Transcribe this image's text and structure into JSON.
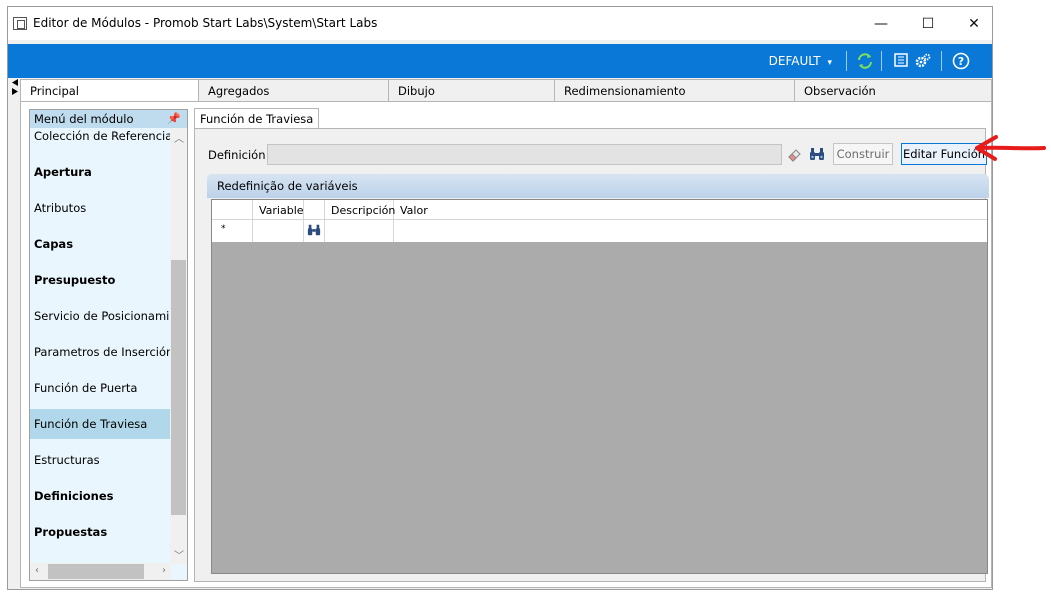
{
  "window": {
    "title": "Editor de Módulos - Promob Start Labs\\System\\Start Labs",
    "minimize": "—",
    "maximize": "☐",
    "close": "✕"
  },
  "toolbar": {
    "profile": "DEFAULT",
    "profile_caret": "▾",
    "icons": [
      "refresh-icon",
      "module-list-icon",
      "settings-gears-icon",
      "help-icon"
    ],
    "accent": "#0a78d7"
  },
  "tabs": [
    {
      "label": "Principal",
      "active": true
    },
    {
      "label": "Agregados"
    },
    {
      "label": "Dibujo"
    },
    {
      "label": "Redimensionamiento"
    },
    {
      "label": "Observación"
    }
  ],
  "left_panel": {
    "header": "Menú del módulo",
    "items": [
      {
        "label": "Colección de Referencias"
      },
      {
        "label": "Apertura",
        "bold": true
      },
      {
        "label": "Atributos"
      },
      {
        "label": "Capas",
        "bold": true
      },
      {
        "label": "Presupuesto",
        "bold": true
      },
      {
        "label": "Servicio de Posicionamiento"
      },
      {
        "label": "Parametros de Inserción"
      },
      {
        "label": "Función de Puerta"
      },
      {
        "label": "Función de Traviesa",
        "selected": true
      },
      {
        "label": "Estructuras"
      },
      {
        "label": "Definiciones",
        "bold": true
      },
      {
        "label": "Propuestas",
        "bold": true
      }
    ]
  },
  "subtab": {
    "label": "Función de Traviesa"
  },
  "definition": {
    "label": "Definición",
    "value": "",
    "construir": "Construir",
    "editar": "Editar Función"
  },
  "group": {
    "title": "Redefinição de variáveis",
    "columns": [
      "",
      "Variable",
      "",
      "Descripción",
      "Valor"
    ],
    "new_row_marker": "*"
  }
}
